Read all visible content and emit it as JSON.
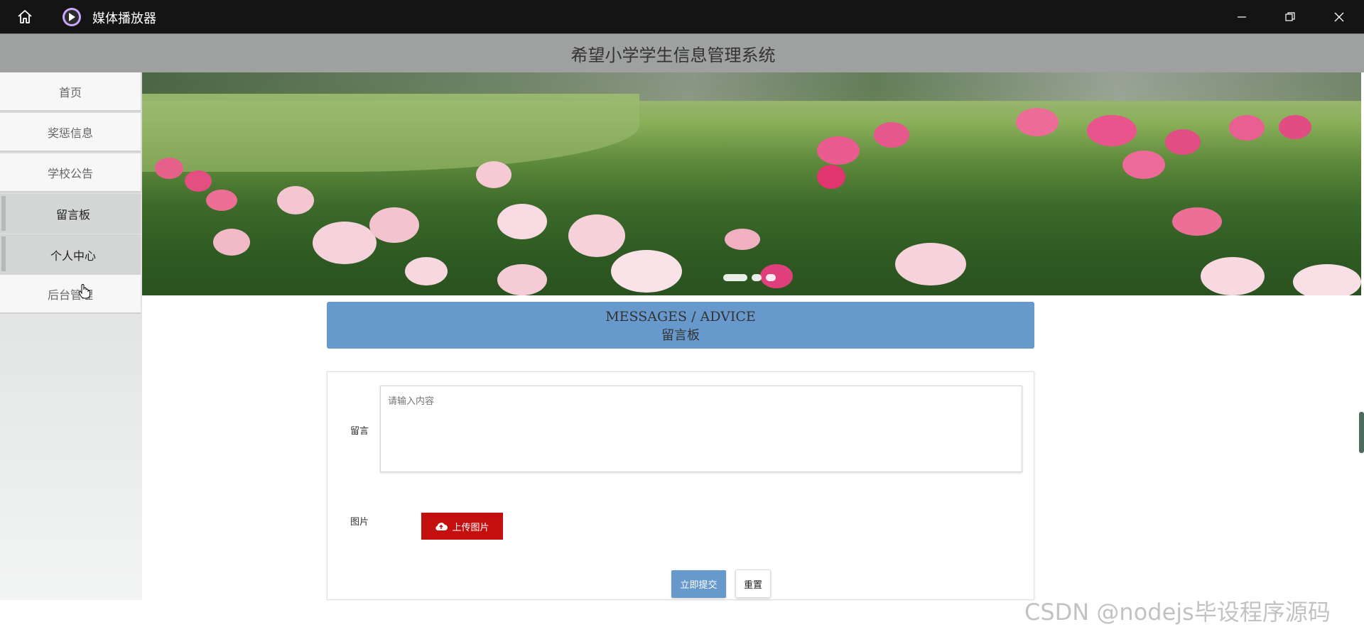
{
  "window": {
    "title": "媒体播放器",
    "icons": {
      "home": "home-icon",
      "app": "play-icon",
      "minimize": "minimize-icon",
      "restore": "restore-icon",
      "close": "close-icon"
    }
  },
  "header": {
    "title": "希望小学学生信息管理系统"
  },
  "sidebar": {
    "items": [
      {
        "label": "首页",
        "selected": false
      },
      {
        "label": "奖惩信息",
        "selected": false
      },
      {
        "label": "学校公告",
        "selected": false
      },
      {
        "label": "留言板",
        "selected": true
      },
      {
        "label": "个人中心",
        "selected": true
      },
      {
        "label": "后台管理",
        "selected": false
      }
    ]
  },
  "carousel": {
    "slides": 3,
    "active_index": 0
  },
  "message_board": {
    "heading_en": "MESSAGES / ADVICE",
    "heading_zh": "留言板"
  },
  "form": {
    "message_label": "留言",
    "message_placeholder": "请输入内容",
    "message_value": "",
    "image_label": "图片",
    "upload_label": "上传图片",
    "submit_label": "立即提交",
    "reset_label": "重置"
  },
  "watermark": "CSDN @nodejs毕设程序源码",
  "colors": {
    "accent_blue": "#6799cc",
    "upload_red": "#c40f0f",
    "header_gray": "#9fa1a1",
    "titlebar": "#141414"
  }
}
